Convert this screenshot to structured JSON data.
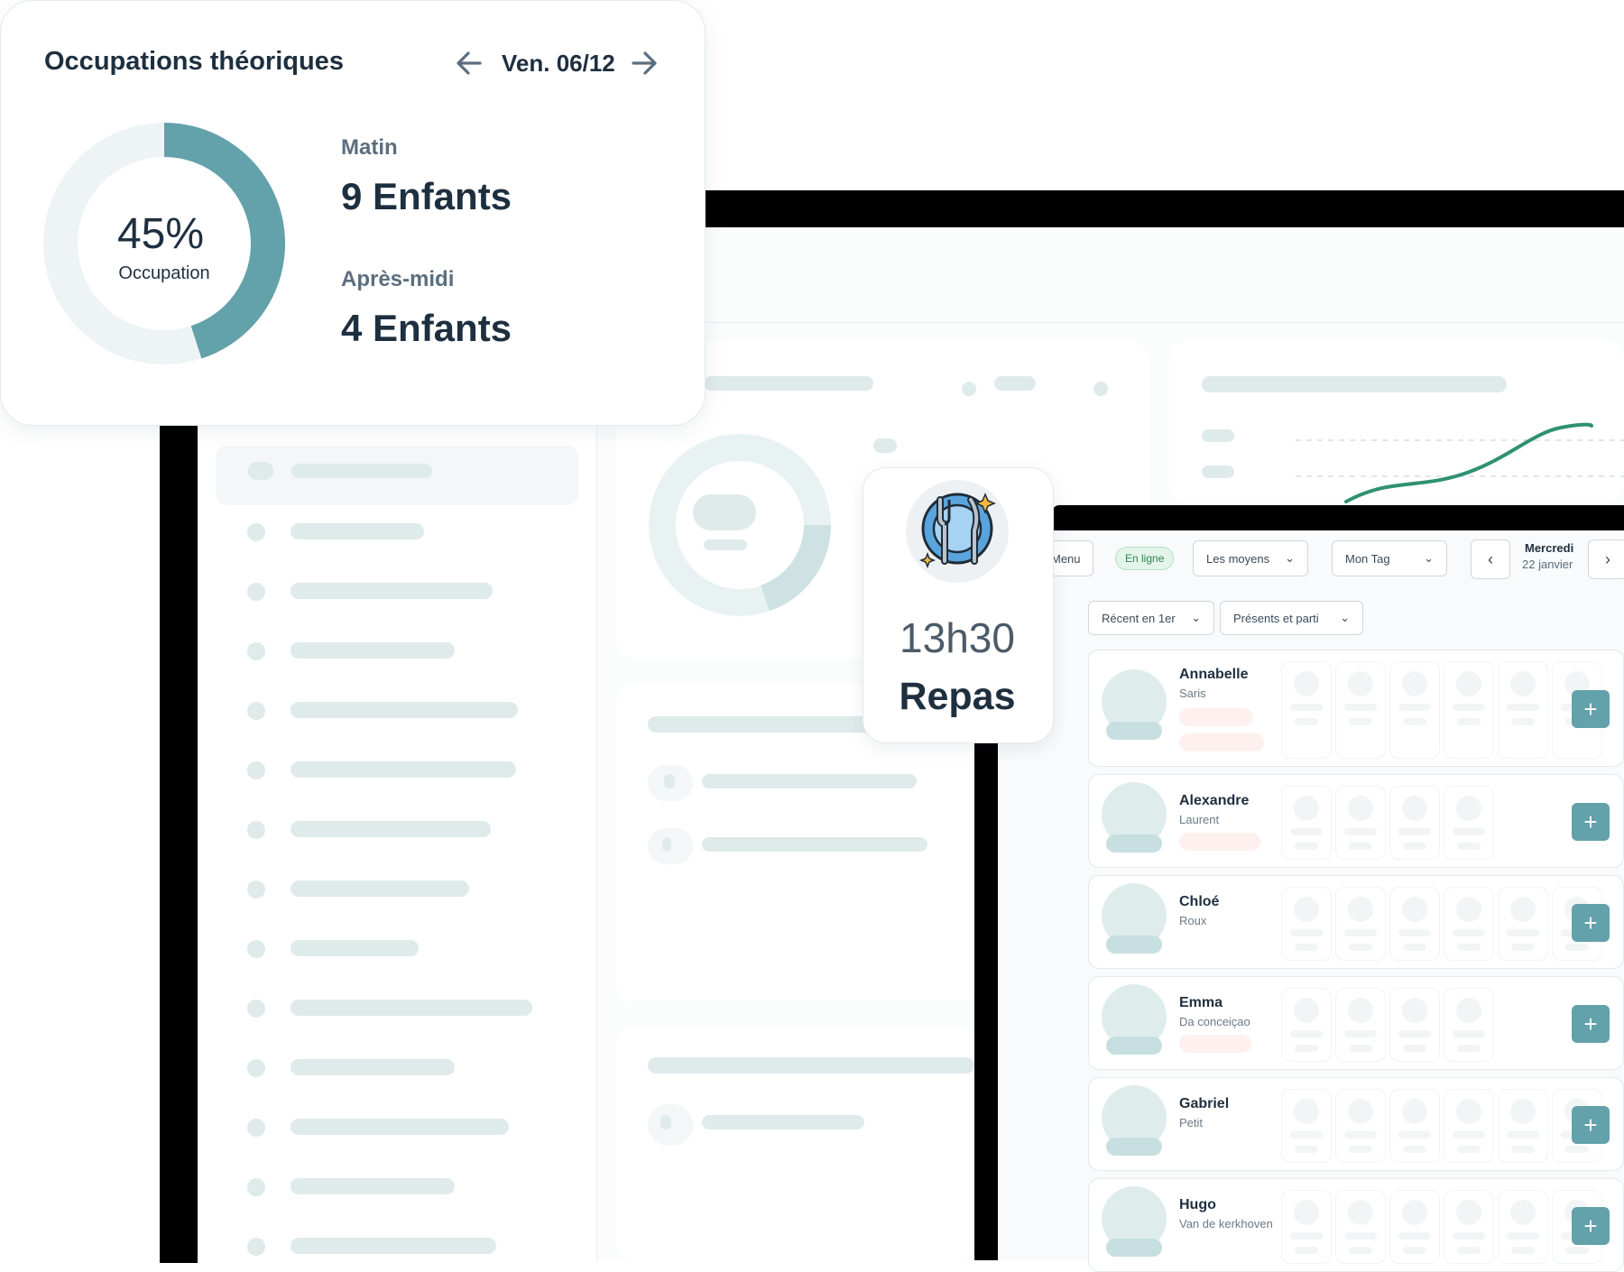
{
  "occupation_card": {
    "title": "Occupations théoriques",
    "date": "Ven. 06/12",
    "percent": "45%",
    "percent_value": 45,
    "percent_label": "Occupation",
    "morning_label": "Matin",
    "morning_value": "9 Enfants",
    "afternoon_label": "Après-midi",
    "afternoon_value": "4 Enfants"
  },
  "meal_card": {
    "time": "13h30",
    "label": "Repas",
    "icon": "plate-cutlery-icon"
  },
  "tablet": {
    "menu_label": "Menu",
    "status_badge": "En ligne",
    "filter_means": "Les moyens",
    "filter_tag": "Mon Tag",
    "date_day": "Mercredi",
    "date_sub": "22 janvier",
    "sort_label": "Récent en 1er",
    "presence_filter": "Présents et parti",
    "children": [
      {
        "first": "Annabelle",
        "last": "Saris"
      },
      {
        "first": "Alexandre",
        "last": "Laurent"
      },
      {
        "first": "Chloé",
        "last": "Roux"
      },
      {
        "first": "Emma",
        "last": "Da conceiçao"
      },
      {
        "first": "Gabriel",
        "last": "Petit"
      },
      {
        "first": "Hugo",
        "last": "Van de kerkhoven"
      }
    ]
  },
  "colors": {
    "accent": "#63a1ab",
    "donut_track": "#eef4f5",
    "line_chart": "#2f9171",
    "dark_text": "#1e2f3f"
  }
}
